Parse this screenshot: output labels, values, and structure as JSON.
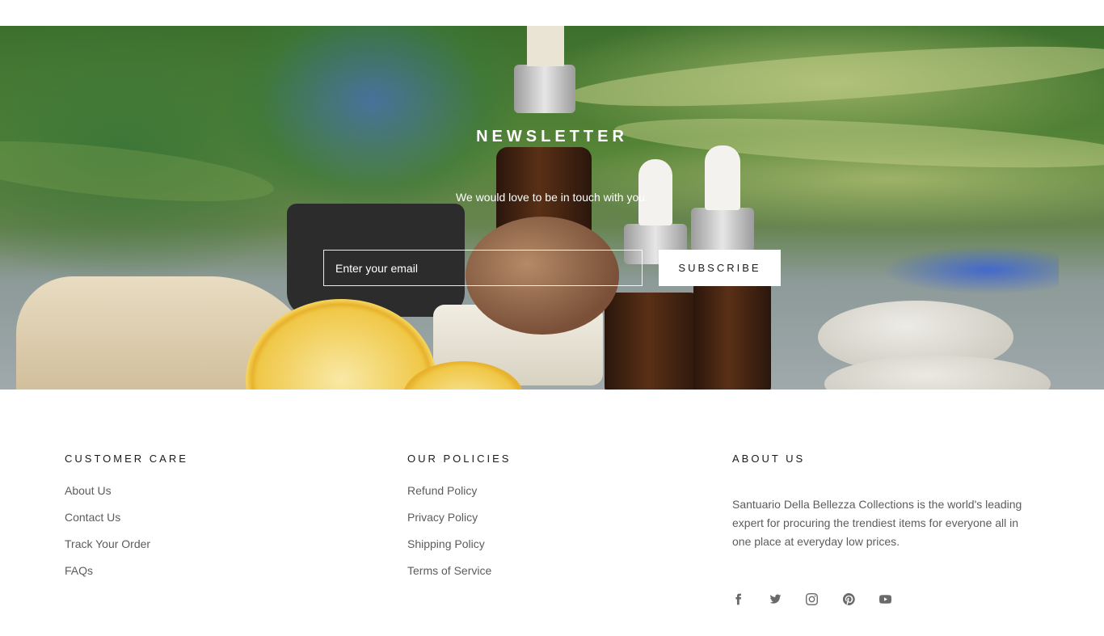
{
  "newsletter": {
    "title": "NEWSLETTER",
    "subtitle": "We would love to be in touch with you.",
    "email_placeholder": "Enter your email",
    "subscribe_label": "SUBSCRIBE"
  },
  "footer": {
    "customer_care": {
      "heading": "CUSTOMER CARE",
      "links": [
        "About Us",
        "Contact Us",
        "Track Your Order",
        "FAQs"
      ]
    },
    "policies": {
      "heading": "OUR POLICIES",
      "links": [
        "Refund Policy",
        "Privacy Policy",
        "Shipping Policy",
        "Terms of Service"
      ]
    },
    "about": {
      "heading": "ABOUT US",
      "text": "Santuario Della Bellezza Collections is the world's leading expert for procuring the trendiest items for everyone all in one place at everyday low prices."
    },
    "social_icons": [
      "facebook-icon",
      "twitter-icon",
      "instagram-icon",
      "pinterest-icon",
      "youtube-icon"
    ]
  },
  "colors": {
    "text_dark": "#1c1b1b",
    "text_muted": "#5c5c5c",
    "button_bg": "#ffffff"
  }
}
